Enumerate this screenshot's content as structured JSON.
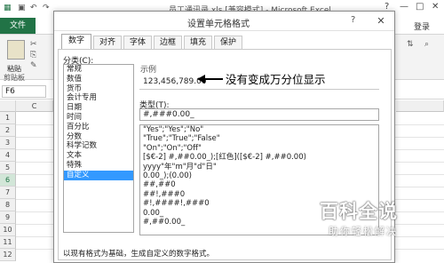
{
  "window": {
    "title": "员工通讯录.xls [兼容模式] - Microsoft Excel",
    "help_btn": "?",
    "minimize_btn": "—",
    "restore_btn": "□",
    "close_btn": "✕"
  },
  "ribbon": {
    "file_tab": "文件",
    "login": "登录",
    "paste": "粘贴",
    "clipboard_group": "剪贴板",
    "name_box": "F6"
  },
  "grid": {
    "column_c": "C",
    "rows": [
      "1",
      "2",
      "3",
      "4",
      "5",
      "6",
      "7",
      "8",
      "9",
      "10",
      "11",
      "12"
    ],
    "selected_row": "6"
  },
  "dialog": {
    "title": "设置单元格格式",
    "help": "?",
    "close": "✕",
    "tabs": [
      "数字",
      "对齐",
      "字体",
      "边框",
      "填充",
      "保护"
    ],
    "active_tab": "数字",
    "category_label": "分类(C):",
    "categories": [
      "常规",
      "数值",
      "货币",
      "会计专用",
      "日期",
      "时间",
      "百分比",
      "分数",
      "科学记数",
      "文本",
      "特殊",
      "自定义"
    ],
    "selected_category": "自定义",
    "sample_label": "示例",
    "sample_value": "123,456,789.00",
    "type_label": "类型(T):",
    "type_value": "#,###0.00_",
    "format_list": [
      "\"Yes\";\"Yes\";\"No\"",
      "\"True\";\"True\";\"False\"",
      "\"On\";\"On\";\"Off\"",
      "[$€-2] #,##0.00_);[红色]([$€-2] #,##0.00)",
      "yyyy\"年\"m\"月\"d\"日\"",
      "0.00_);(0.00)",
      "##,##0",
      "##!,###0",
      "#!,####!,###0",
      "0.00_",
      "#,##0.00_"
    ],
    "hint": "以现有格式为基础，生成自定义的数字格式。"
  },
  "annotation": {
    "text": "没有变成万分位显示"
  },
  "watermark": {
    "title": "百科全说",
    "subtitle": "助你轻松解决"
  }
}
